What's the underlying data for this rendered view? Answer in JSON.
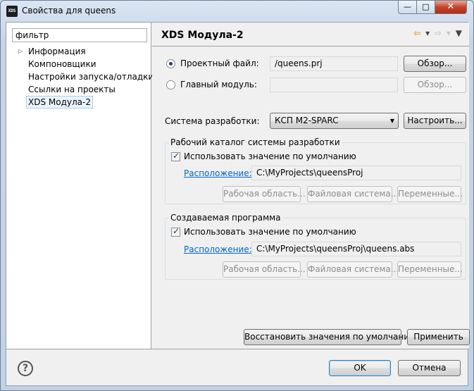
{
  "window": {
    "title": "Свойства для queens",
    "app_icon": "xds-app-icon"
  },
  "title_buttons": {
    "minimize": "—",
    "maximize": "□",
    "close": "✕"
  },
  "sidebar": {
    "filter_value": "фильтр",
    "items": [
      {
        "label": "Информация"
      },
      {
        "label": "Компоновщики"
      },
      {
        "label": "Настройки запуска/отладки"
      },
      {
        "label": "Ссылки на проекты"
      },
      {
        "label": "XDS Модула-2"
      }
    ],
    "expand_glyph": "▷"
  },
  "header": {
    "title": "XDS Модула-2",
    "back_icon": "⇦",
    "forward_icon": "⇨",
    "dropdown_icon": "▾",
    "menu_icon": "▼"
  },
  "project": {
    "project_file_label": "Проектный файл:",
    "project_file_value": "/queens.prj",
    "project_file_selected": true,
    "browse_label": "Обзор...",
    "main_module_label": "Главный модуль:",
    "main_module_value": "",
    "browse_disabled_label": "Обзор..."
  },
  "dev_system": {
    "label": "Система разработки:",
    "selected": "КСП M2-SPARC",
    "configure_label": "Настроить..."
  },
  "workdir_group": {
    "title": "Рабочий каталог системы разработки",
    "use_default_label": "Использовать значение по умолчанию",
    "use_default_checked": true,
    "location_link": "Расположение:",
    "location_value": "C:\\MyProjects\\queensProj",
    "workspace_btn": "Рабочая область...",
    "filesystem_btn": "Файловая система...",
    "variables_btn": "Переменные..."
  },
  "output_group": {
    "title": "Создаваемая программа",
    "use_default_label": "Использовать значение по умолчанию",
    "use_default_checked": true,
    "location_link": "Расположение:",
    "location_value": "C:\\MyProjects\\queensProj\\queens.abs",
    "workspace_btn": "Рабочая область...",
    "filesystem_btn": "Файловая система...",
    "variables_btn": "Переменные..."
  },
  "actions": {
    "restore_defaults": "Восстановить значения по умолчанию",
    "apply": "Применить"
  },
  "footer": {
    "help_glyph": "?",
    "ok": "OK",
    "cancel": "Отмена"
  }
}
